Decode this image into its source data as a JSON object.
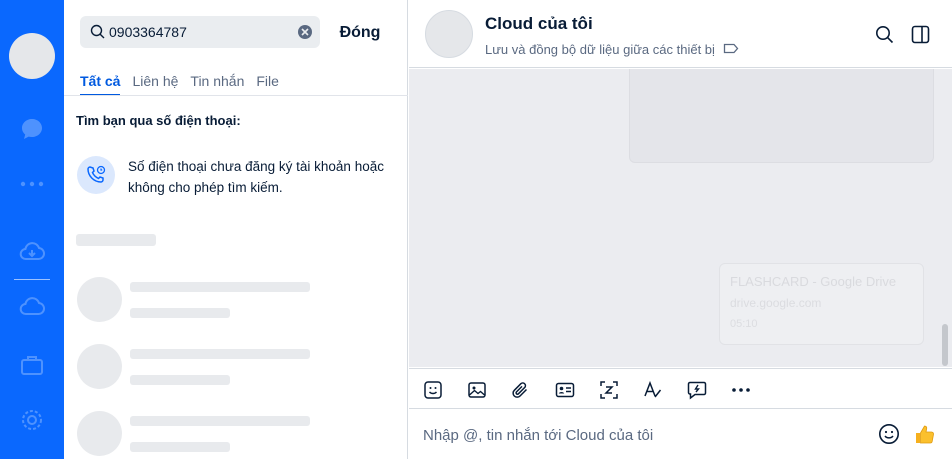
{
  "search": {
    "value": "0903364787",
    "close_label": "Đóng"
  },
  "tabs": [
    {
      "label": "Tất cả"
    },
    {
      "label": "Liên hệ"
    },
    {
      "label": "Tin nhắn"
    },
    {
      "label": "File"
    }
  ],
  "results": {
    "section_title": "Tìm bạn qua số điện thoại:",
    "notice_text": "Số điện thoại chưa đăng ký tài khoản hoặc không cho phép tìm kiếm."
  },
  "chat": {
    "title": "Cloud của tôi",
    "subtitle": "Lưu và đồng bộ dữ liệu giữa các thiết bị",
    "composer_placeholder": "Nhập @, tin nhắn tới Cloud của tôi"
  },
  "background_card": {
    "title": "FLASHCARD - Google Drive",
    "domain": "drive.google.com",
    "time": "05:10"
  },
  "colors": {
    "rail": "#0a68fe",
    "accent": "#005ae0"
  },
  "icons": {
    "rail": [
      "chat-icon",
      "more-icon",
      "cloud-sync-icon",
      "cloud-icon",
      "briefcase-icon",
      "settings-icon"
    ],
    "header": [
      "search-icon",
      "sidebar-toggle-icon"
    ],
    "toolbar": [
      "sticker-icon",
      "image-icon",
      "attachment-icon",
      "contact-card-icon",
      "screenshot-icon",
      "text-format-icon",
      "quick-message-icon",
      "more-icon"
    ],
    "composer": [
      "emoji-icon",
      "thumbs-up-icon"
    ]
  }
}
